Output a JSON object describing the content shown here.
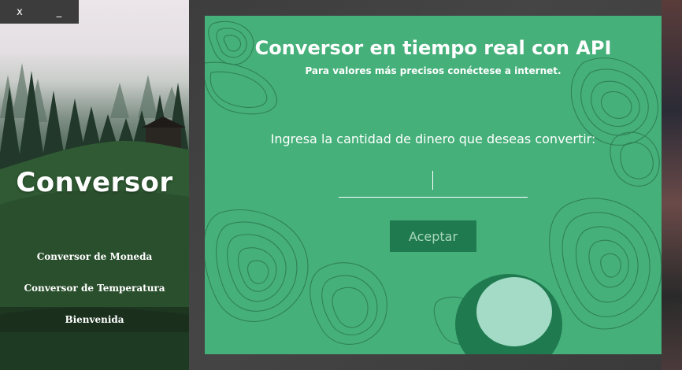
{
  "window": {
    "close_label": "x",
    "minimize_label": "_"
  },
  "sidebar": {
    "brand": "Conversor",
    "items": [
      {
        "label": "Conversor de Moneda",
        "active": false
      },
      {
        "label": "Conversor de Temperatura",
        "active": false
      },
      {
        "label": "Bienvenida",
        "active": true
      }
    ]
  },
  "main": {
    "title": "Conversor en tiempo real con API",
    "subtitle": "Para valores más precisos conéctese a internet.",
    "prompt": "Ingresa la cantidad de dinero que deseas convertir:",
    "amount_value": "",
    "accept_label": "Aceptar"
  },
  "colors": {
    "card_bg": "#45b07a",
    "button_bg": "#1f7a4f",
    "button_text": "#a9d8bd",
    "sidebar_active": "#1f3a22",
    "topo_lines": "#1f5a3c"
  }
}
